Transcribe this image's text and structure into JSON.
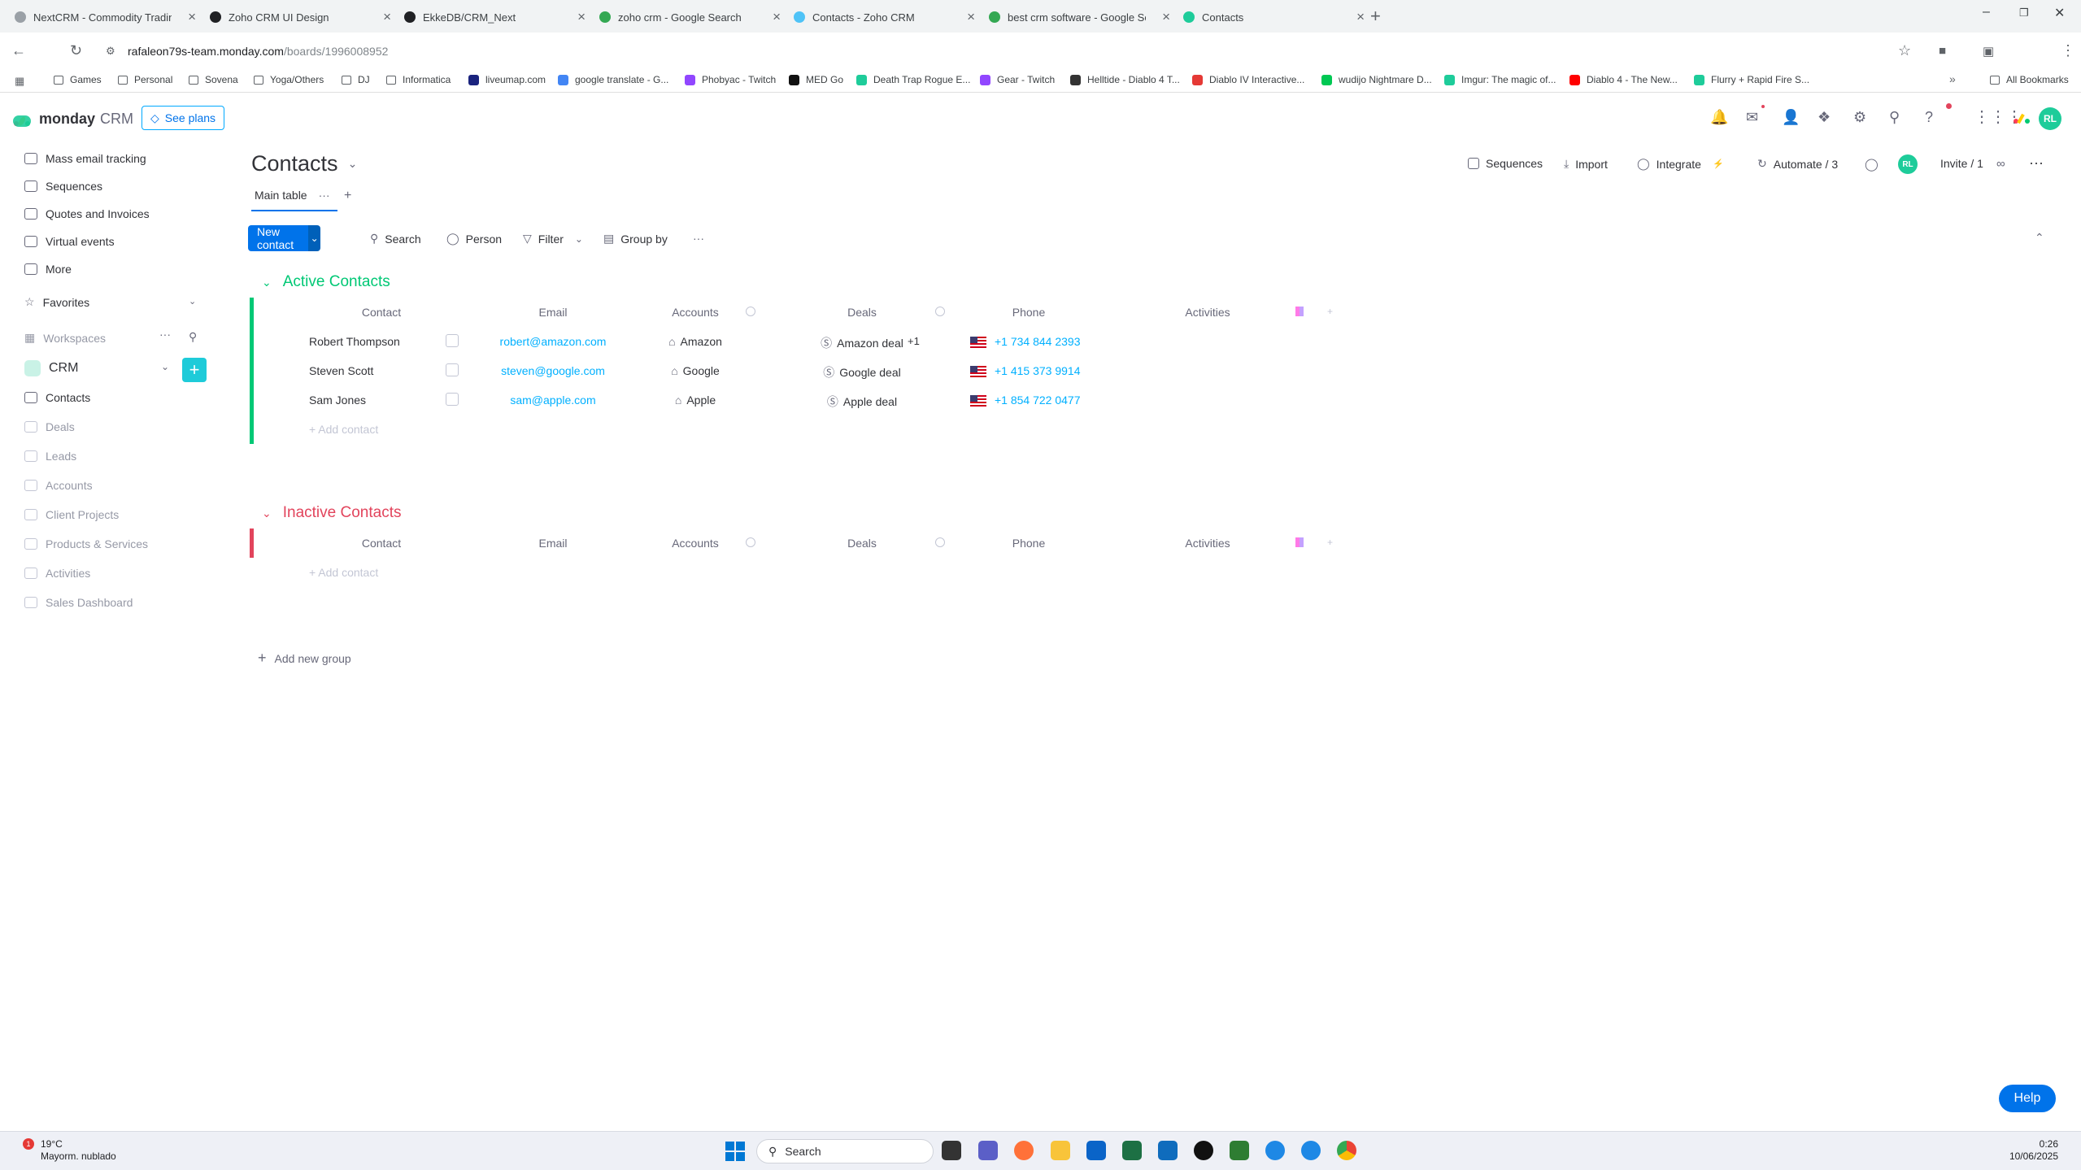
{
  "browser": {
    "tabs": [
      {
        "title": "NextCRM - Commodity Tradin",
        "color": "#9aa0a6"
      },
      {
        "title": "Zoho CRM UI Design",
        "color": "#202124"
      },
      {
        "title": "EkkeDB/CRM_Next",
        "color": "#202124"
      },
      {
        "title": "zoho crm - Google Search",
        "color": "#34a853"
      },
      {
        "title": "Contacts - Zoho CRM",
        "color": "#4fc3f7"
      },
      {
        "title": "best crm software - Google Se",
        "color": "#34a853"
      },
      {
        "title": "Contacts",
        "color": "#1ecc9a"
      }
    ],
    "url_host": "rafaleon79s-team.monday.com",
    "url_path": "/boards/1996008952",
    "bookmarks": [
      {
        "label": "Games",
        "type": "folder"
      },
      {
        "label": "Personal",
        "type": "folder"
      },
      {
        "label": "Sovena",
        "type": "folder"
      },
      {
        "label": "Yoga/Others",
        "type": "folder"
      },
      {
        "label": "DJ",
        "type": "folder"
      },
      {
        "label": "Informatica",
        "type": "folder"
      },
      {
        "label": "liveumap.com",
        "type": "site",
        "color": "#1a237e"
      },
      {
        "label": "google translate - G...",
        "type": "site",
        "color": "#4285f4"
      },
      {
        "label": "Phobyac - Twitch",
        "type": "site",
        "color": "#9146ff"
      },
      {
        "label": "MED Go",
        "type": "site",
        "color": "#111111"
      },
      {
        "label": "Death Trap Rogue E...",
        "type": "site",
        "color": "#1ecc9a"
      },
      {
        "label": "Gear - Twitch",
        "type": "site",
        "color": "#9146ff"
      },
      {
        "label": "Helltide - Diablo 4 T...",
        "type": "site",
        "color": "#333333"
      },
      {
        "label": "Diablo IV Interactive...",
        "type": "site",
        "color": "#e53935"
      },
      {
        "label": "wudijo Nightmare D...",
        "type": "site",
        "color": "#00c853"
      },
      {
        "label": "Imgur: The magic of...",
        "type": "site",
        "color": "#1ecc9a"
      },
      {
        "label": "Diablo 4 - The New...",
        "type": "site",
        "color": "#ff0000"
      },
      {
        "label": "Flurry + Rapid Fire S...",
        "type": "site",
        "color": "#1ecc9a"
      }
    ],
    "all_bookmarks": "All Bookmarks"
  },
  "app": {
    "brand": "monday",
    "product": "CRM",
    "see_plans": "See plans",
    "user_initials": "RL"
  },
  "sidebar": {
    "items": [
      {
        "label": "Mass email tracking"
      },
      {
        "label": "Sequences"
      },
      {
        "label": "Quotes and Invoices"
      },
      {
        "label": "Virtual events"
      },
      {
        "label": "More"
      }
    ],
    "favorites": "Favorites",
    "workspaces": "Workspaces",
    "workspace_name": "CRM",
    "boards": [
      {
        "label": "Contacts",
        "active": true
      },
      {
        "label": "Deals"
      },
      {
        "label": "Leads"
      },
      {
        "label": "Accounts"
      },
      {
        "label": "Client Projects"
      },
      {
        "label": "Products & Services"
      },
      {
        "label": "Activities"
      },
      {
        "label": "Sales Dashboard"
      }
    ]
  },
  "board": {
    "title": "Contacts",
    "view_tab": "Main table",
    "actions": {
      "sequences": "Sequences",
      "import": "Import",
      "integrate": "Integrate",
      "automate": "Automate / 3",
      "invite": "Invite / 1"
    },
    "toolbar": {
      "new_contact": "New contact",
      "search": "Search",
      "person": "Person",
      "filter": "Filter",
      "group_by": "Group by"
    },
    "columns": [
      "Contact",
      "Email",
      "Accounts",
      "Deals",
      "Phone",
      "Activities"
    ],
    "groups": [
      {
        "title": "Active Contacts",
        "color": "#00c875",
        "rows": [
          {
            "contact": "Robert Thompson",
            "email": "robert@amazon.com",
            "account": "Amazon",
            "deal": "Amazon deal",
            "deal_extra": "+1",
            "phone": "+1 734 844 2393"
          },
          {
            "contact": "Steven Scott",
            "email": "steven@google.com",
            "account": "Google",
            "deal": "Google deal",
            "deal_extra": "",
            "phone": "+1 415 373 9914"
          },
          {
            "contact": "Sam Jones",
            "email": "sam@apple.com",
            "account": "Apple",
            "deal": "Apple deal",
            "deal_extra": "",
            "phone": "+1 854 722 0477"
          }
        ],
        "add": "+ Add contact"
      },
      {
        "title": "Inactive Contacts",
        "color": "#e2445c",
        "rows": [],
        "add": "+ Add contact"
      }
    ],
    "add_group": "Add new group"
  },
  "help": "Help",
  "taskbar": {
    "temp": "19°C",
    "weather": "Mayorm. nublado",
    "weather_badge": "1",
    "search": "Search",
    "time": "0:26",
    "date": "10/06/2025"
  }
}
